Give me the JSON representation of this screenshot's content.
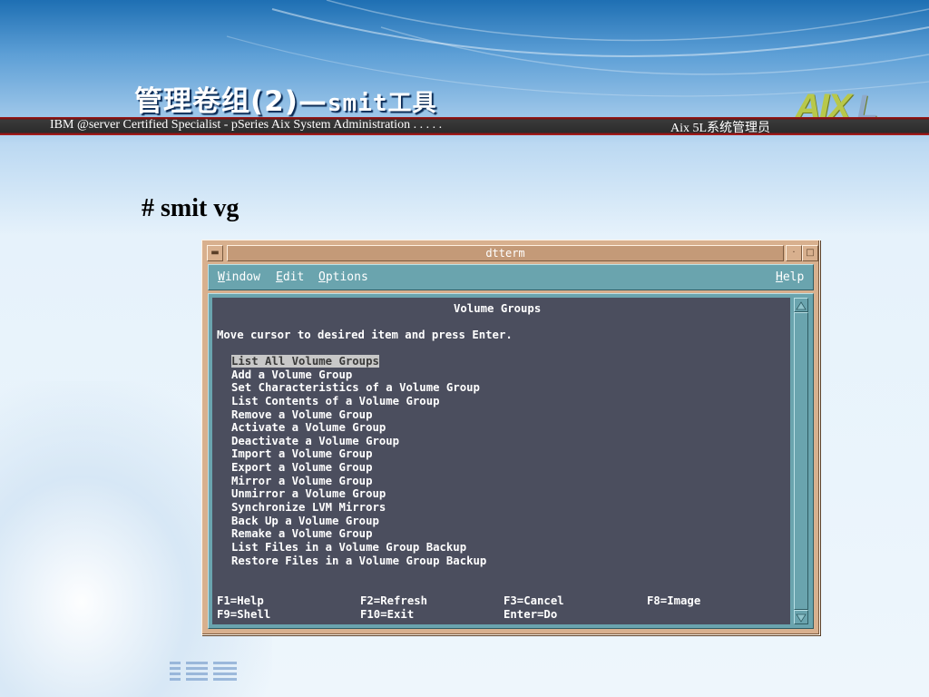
{
  "slide": {
    "title": "管理卷组(2)—",
    "title_tool": "smit工具",
    "logo_text": "AIX",
    "logo_letter": "L",
    "banner_left": "IBM @server Certified Specialist - pSeries Aix System Administration . . . . .",
    "banner_right": "Aix 5L系统管理员",
    "command": "# smit vg"
  },
  "window": {
    "title": "dtterm",
    "menu": [
      {
        "key": "W",
        "rest": "indow"
      },
      {
        "key": "E",
        "rest": "dit"
      },
      {
        "key": "O",
        "rest": "ptions"
      }
    ],
    "help": {
      "key": "H",
      "rest": "elp"
    }
  },
  "terminal": {
    "heading": "Volume Groups",
    "prompt": "Move cursor to desired item and press Enter.",
    "items": [
      "List All Volume Groups",
      "Add a Volume Group",
      "Set Characteristics of a Volume Group",
      "List Contents of a Volume Group",
      "Remove a Volume Group",
      "Activate a Volume Group",
      "Deactivate a Volume Group",
      "Import a Volume Group",
      "Export a Volume Group",
      "Mirror a Volume Group",
      "Unmirror a Volume Group",
      "Synchronize LVM Mirrors",
      "Back Up a Volume Group",
      "Remake a Volume Group",
      "List Files in a Volume Group Backup",
      "Restore Files in a Volume Group Backup"
    ],
    "selected_index": 0,
    "fkeys": [
      [
        "F1=Help",
        "F2=Refresh",
        "F3=Cancel",
        "F8=Image"
      ],
      [
        "F9=Shell",
        "F10=Exit",
        "Enter=Do"
      ]
    ]
  },
  "colors": {
    "terminal_bg": "#4b4e5e",
    "menubar_bg": "#6aa4ae",
    "window_frame": "#d8b08e",
    "banner_accent": "#9a1d1d"
  }
}
